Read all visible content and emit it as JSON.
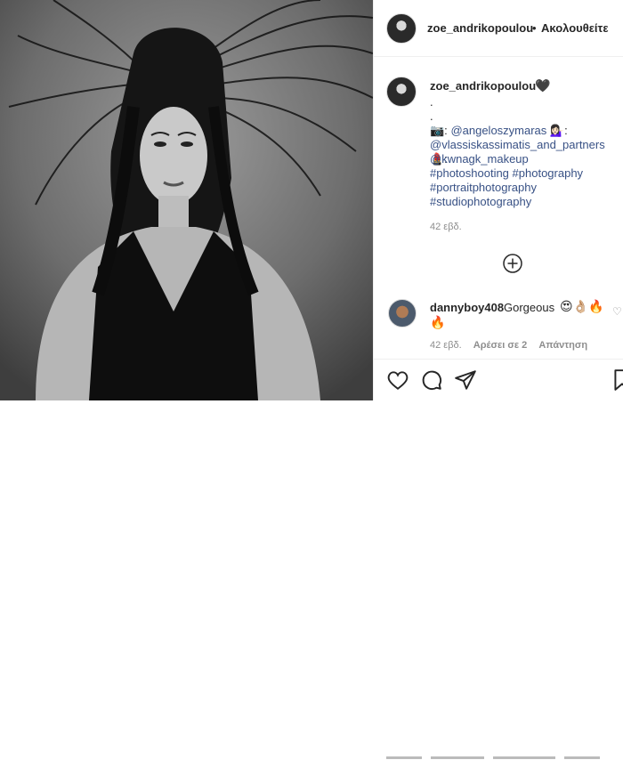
{
  "post": {
    "username": "zoe_andrikopoulou",
    "follow_separator": "•",
    "follow_label": "Ακολουθείτε",
    "photo_alt": "Black and white portrait of a woman with long flowing hair"
  },
  "caption": {
    "username": "zoe_andrikopoulou",
    "heart": "🖤",
    "dot1": ".",
    "dot2": ".",
    "camera": "📷:",
    "credit1": "@angeloszymaras",
    "credit1_emoji": "💁🏻‍♀️:",
    "credit2": "@vlassiskassimatis_and_partners",
    "credit2_emoji": "💄:",
    "credit3": "@kwnagk_makeup",
    "tags": [
      "#photoshooting",
      "#photography",
      "#portraitphotography",
      "#studiophotography"
    ],
    "time": "42 εβδ."
  },
  "comment": {
    "username": "dannyboy408",
    "text": "Gorgeous",
    "emoji1": "😍👌🏼🔥",
    "emoji2": "🔥",
    "time": "42 εβδ.",
    "likes": "Αρέσει σε 2",
    "reply": "Απάντηση"
  },
  "icons": [
    "add-comments-icon",
    "like-heart-icon",
    "comment-icon",
    "share-icon",
    "save-icon",
    "verified-dot"
  ]
}
